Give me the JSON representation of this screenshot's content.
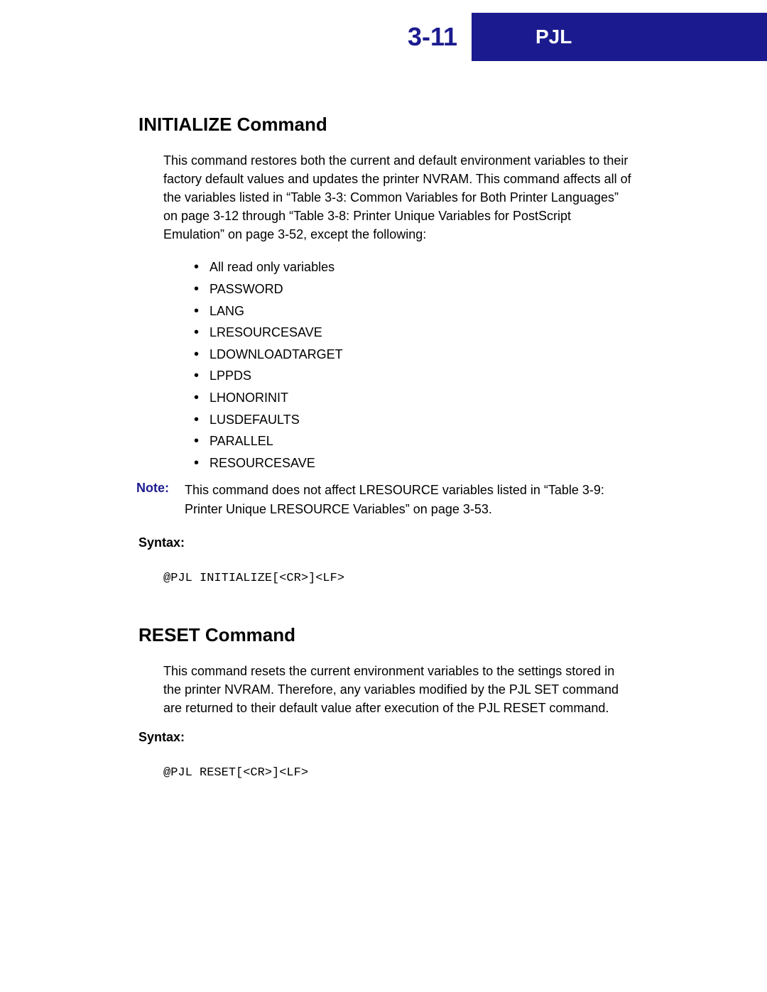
{
  "header": {
    "page_number": "3-11",
    "chapter": "PJL"
  },
  "section1": {
    "heading": "INITIALIZE Command",
    "intro": "This command restores both the current and default environment variables to their factory default values and updates the printer NVRAM. This command affects all of the variables listed in “Table 3-3: Common Variables for Both Printer Languages” on page 3-12 through “Table 3-8: Printer Unique Variables for PostScript Emulation” on page 3-52, except the following:",
    "bullets": [
      "All read only variables",
      "PASSWORD",
      "LANG",
      "LRESOURCESAVE",
      "LDOWNLOADTARGET",
      "LPPDS",
      "LHONORINIT",
      "LUSDEFAULTS",
      "PARALLEL",
      "RESOURCESAVE"
    ],
    "note_label": "Note:",
    "note_text": "This command does not affect LRESOURCE variables listed in “Table 3-9: Printer Unique LRESOURCE Variables” on page 3-53.",
    "syntax_label": "Syntax:",
    "syntax_code": "@PJL INITIALIZE[<CR>]<LF>"
  },
  "section2": {
    "heading": "RESET Command",
    "intro": "This command resets the current environment variables to the settings stored in the printer NVRAM. Therefore, any variables modified by the PJL SET command are returned to their default value after execution of the PJL RESET command.",
    "syntax_label": "Syntax:",
    "syntax_code": "@PJL RESET[<CR>]<LF>"
  }
}
